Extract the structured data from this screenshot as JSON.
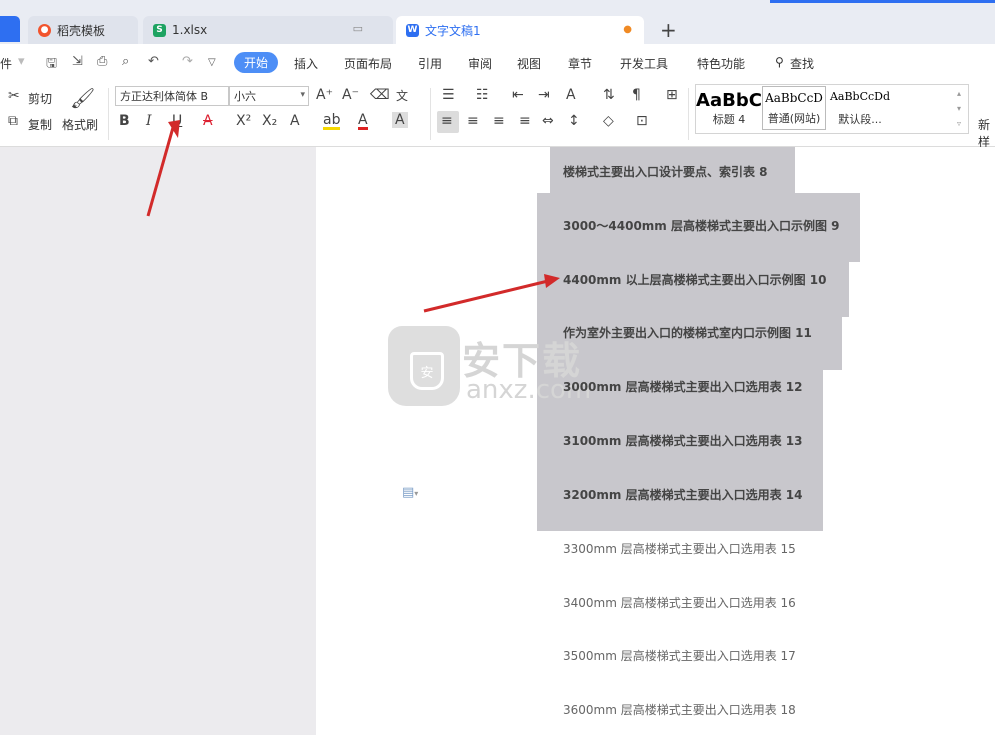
{
  "tabs": [
    {
      "label": "稻壳模板"
    },
    {
      "label": "1.xlsx"
    },
    {
      "label": "文字文稿1"
    }
  ],
  "menu": {
    "file": "件",
    "items": [
      "开始",
      "插入",
      "页面布局",
      "引用",
      "审阅",
      "视图",
      "章节",
      "开发工具",
      "特色功能"
    ],
    "search": "查找"
  },
  "toolbar": {
    "cut": "剪切",
    "copy": "复制",
    "format_painter": "格式刷",
    "font_name": "方正达利体简体 B",
    "font_size": "小六",
    "bold": "B",
    "italic": "I",
    "underline": "U"
  },
  "styles": [
    {
      "preview": "AaBbC",
      "label": "标题 4"
    },
    {
      "preview": "AaBbCcD",
      "label": "普通(网站)"
    },
    {
      "preview": "AaBbCcDd",
      "label": "默认段..."
    }
  ],
  "styles_new": "新样",
  "document": {
    "lines": [
      "楼梯式主要出入口设计要点、索引表 8",
      "3000～4400mm 层高楼梯式主要出入口示例图 9",
      "4400mm 以上层高楼梯式主要出入口示例图 10",
      "作为室外主要出入口的楼梯式室内口示例图 11",
      "3000mm 层高楼梯式主要出入口选用表 12",
      "3100mm 层高楼梯式主要出入口选用表 13",
      "3200mm 层高楼梯式主要出入口选用表 14",
      "3300mm 层高楼梯式主要出入口选用表 15",
      "3400mm 层高楼梯式主要出入口选用表 16",
      "3500mm 层高楼梯式主要出入口选用表 17",
      "3600mm 层高楼梯式主要出入口选用表 18"
    ]
  },
  "watermark": {
    "text": "安下载",
    "sub": "anxz.com"
  },
  "colors": {
    "accent": "#4d8ef6",
    "selection": "#c8c7cc",
    "arrow": "#d22a2a"
  }
}
